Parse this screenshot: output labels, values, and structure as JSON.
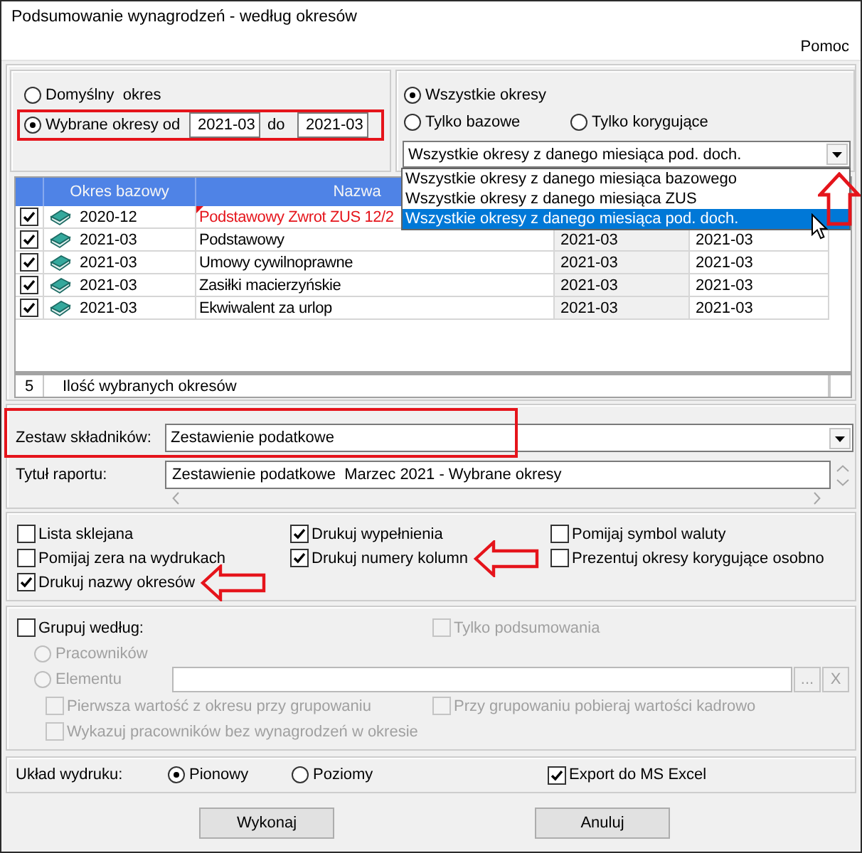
{
  "window": {
    "title": "Podsumowanie wynagrodzeń - według okresów"
  },
  "menu": [
    {
      "label": "Pomoc"
    }
  ],
  "period_mode": {
    "options": [
      {
        "kind": "default",
        "label": "Domyślny  okres",
        "selected": false,
        "framed": false
      },
      {
        "kind": "range",
        "label": "Wybrane okresy od",
        "selected": true,
        "framed": true,
        "from": "2021-03",
        "to_label": "do",
        "to": "2021-03"
      }
    ]
  },
  "period_filter": {
    "options": [
      {
        "label": "Wszystkie okresy",
        "selected": true
      },
      {
        "label": "Tylko bazowe",
        "selected": false
      },
      {
        "label": "Tylko korygujące",
        "selected": false
      }
    ],
    "combo": {
      "value": "Wszystkie okresy z danego miesiąca pod. doch.",
      "expanded": true,
      "callout": true,
      "options": [
        {
          "label": "Wszystkie okresy z danego miesiąca bazowego",
          "selected": false
        },
        {
          "label": "Wszystkie okresy z danego miesiąca ZUS",
          "selected": false
        },
        {
          "label": "Wszystkie okresy z danego miesiąca pod. doch.",
          "selected": true
        }
      ]
    }
  },
  "table": {
    "columns": [
      "Okres bazowy",
      "Nazwa"
    ],
    "rows": [
      {
        "kind": "correction",
        "checked": true,
        "period": "2020-12",
        "name": "Podstawowy Zwrot ZUS 12/2"
      },
      {
        "kind": "base",
        "checked": true,
        "period": "2021-03",
        "name": "Podstawowy",
        "column_4": "2021-03",
        "column_5": "2021-03"
      },
      {
        "kind": "base",
        "checked": true,
        "period": "2021-03",
        "name": "Umowy cywilnoprawne",
        "column_4": "2021-03",
        "column_5": "2021-03"
      },
      {
        "kind": "base",
        "checked": true,
        "period": "2021-03",
        "name": "Zasiłki macierzyńskie",
        "column_4": "2021-03",
        "column_5": "2021-03"
      },
      {
        "kind": "base",
        "checked": true,
        "period": "2021-03",
        "name": "Ekwiwalent za urlop",
        "column_4": "2021-03",
        "column_5": "2021-03"
      }
    ],
    "footer": {
      "count": "5",
      "label": "Ilość wybranych okresów"
    }
  },
  "component_set": {
    "label": "Zestaw składników:",
    "value": "Zestawienie podatkowe",
    "framed": true
  },
  "report_title": {
    "label": "Tytuł raportu:",
    "value": "Zestawienie podatkowe  Marzec 2021 - Wybrane okresy"
  },
  "print_options": [
    [
      {
        "label": "Lista sklejana",
        "checked": false,
        "callout": false
      },
      {
        "label": "Pomijaj zera na wydrukach",
        "checked": false,
        "callout": false
      },
      {
        "label": "Drukuj nazwy okresów",
        "checked": true,
        "callout": true
      }
    ],
    [
      {
        "label": "Drukuj wypełnienia",
        "checked": true,
        "callout": false
      },
      {
        "label": "Drukuj numery kolumn",
        "checked": true,
        "callout": true
      }
    ],
    [
      {
        "label": "Pomijaj symbol waluty",
        "checked": false,
        "callout": false
      },
      {
        "label": "Prezentuj okresy korygujące osobno",
        "checked": false,
        "callout": false
      }
    ]
  ],
  "grouping": {
    "group_by": {
      "label": "Grupuj według:",
      "checked": false,
      "disabled": false
    },
    "summary_only": {
      "label": "Tylko podsumowania",
      "checked": false,
      "disabled": true
    },
    "by": [
      {
        "label": "Pracowników",
        "selected": false,
        "disabled": true
      },
      {
        "label": "Elementu",
        "selected": false,
        "disabled": true
      }
    ],
    "element_buttons": [
      {
        "label": "...",
        "disabled": true
      },
      {
        "label": "X",
        "disabled": true
      }
    ],
    "options": [
      [
        {
          "label": "Pierwsza wartość z okresu przy grupowaniu",
          "checked": false,
          "disabled": true
        },
        {
          "label": "Przy grupowaniu pobieraj wartości kadrowo",
          "checked": false,
          "disabled": true
        }
      ],
      [
        {
          "label": "Wykazuj pracowników bez wynagrodzeń w okresie",
          "checked": false,
          "disabled": true
        }
      ]
    ]
  },
  "print_layout": {
    "label": "Układ wydruku:",
    "options": [
      {
        "label": "Pionowy",
        "selected": true
      },
      {
        "label": "Poziomy",
        "selected": false
      }
    ],
    "export": {
      "label": "Export do MS Excel",
      "checked": true
    }
  },
  "buttons": [
    {
      "label": "Wykonaj"
    },
    {
      "label": "Anuluj"
    }
  ]
}
